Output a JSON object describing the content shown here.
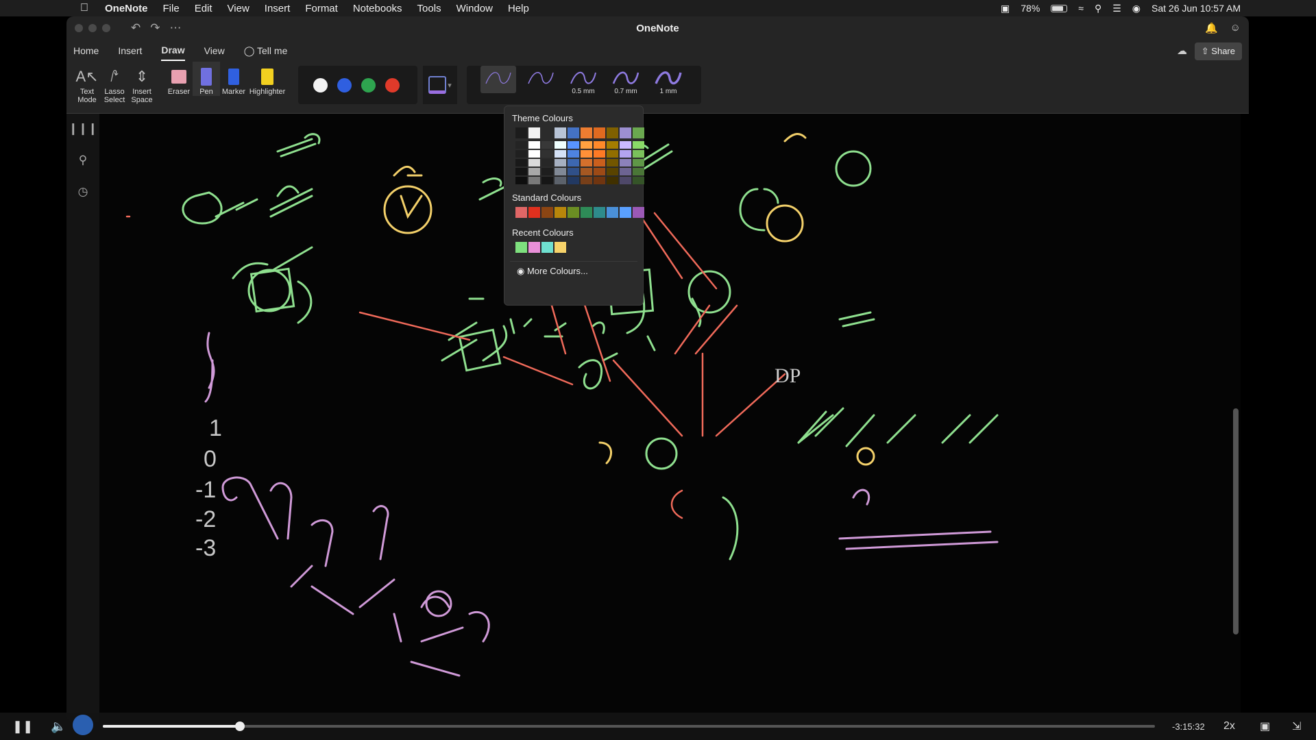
{
  "menubar": {
    "app": "OneNote",
    "items": [
      "File",
      "Edit",
      "View",
      "Insert",
      "Format",
      "Notebooks",
      "Tools",
      "Window",
      "Help"
    ],
    "battery": "78%",
    "datetime": "Sat 26 Jun  10:57 AM"
  },
  "window": {
    "title": "OneNote",
    "tabs": [
      "Home",
      "Insert",
      "Draw",
      "View"
    ],
    "tell_me": "Tell me",
    "share": "Share"
  },
  "ribbon": {
    "tools": [
      {
        "label": "Text\nMode",
        "icon": "text-mode-icon"
      },
      {
        "label": "Lasso\nSelect",
        "icon": "lasso-icon"
      },
      {
        "label": "Insert\nSpace",
        "icon": "insert-space-icon"
      },
      {
        "label": "Eraser",
        "icon": "eraser-icon"
      },
      {
        "label": "Pen",
        "icon": "pen-icon"
      },
      {
        "label": "Marker",
        "icon": "marker-icon"
      },
      {
        "label": "Highlighter",
        "icon": "highlighter-icon"
      }
    ],
    "pen_colors": [
      "#f2f2f2",
      "#2f5fe0",
      "#2ea44f",
      "#e03a2a"
    ],
    "strokes": [
      "",
      "",
      "0.5 mm",
      "0.7 mm",
      "1 mm"
    ]
  },
  "color_menu": {
    "theme_heading": "Theme Colours",
    "standard_heading": "Standard Colours",
    "recent_heading": "Recent Colours",
    "more": "More Colours...",
    "theme_top": [
      "#1c1c1c",
      "#f2f2f2",
      "#2b2b2b",
      "#b8c4d6",
      "#4472c4",
      "#ed7d31",
      "#e06a20",
      "#7f6000",
      "#9c8fd0",
      "#6aa84f"
    ],
    "standard": [
      "#e06666",
      "#e0301e",
      "#8b4513",
      "#b8860b",
      "#6b8e23",
      "#2e8b57",
      "#2e8b8b",
      "#4a90d9",
      "#5aa0ff",
      "#9b59b6"
    ],
    "recent": [
      "#7ee07e",
      "#e88fd8",
      "#6fe0d0",
      "#f7d36a"
    ]
  },
  "player": {
    "time": "-3:15:32",
    "speed": "2x",
    "progress": 0.13
  }
}
